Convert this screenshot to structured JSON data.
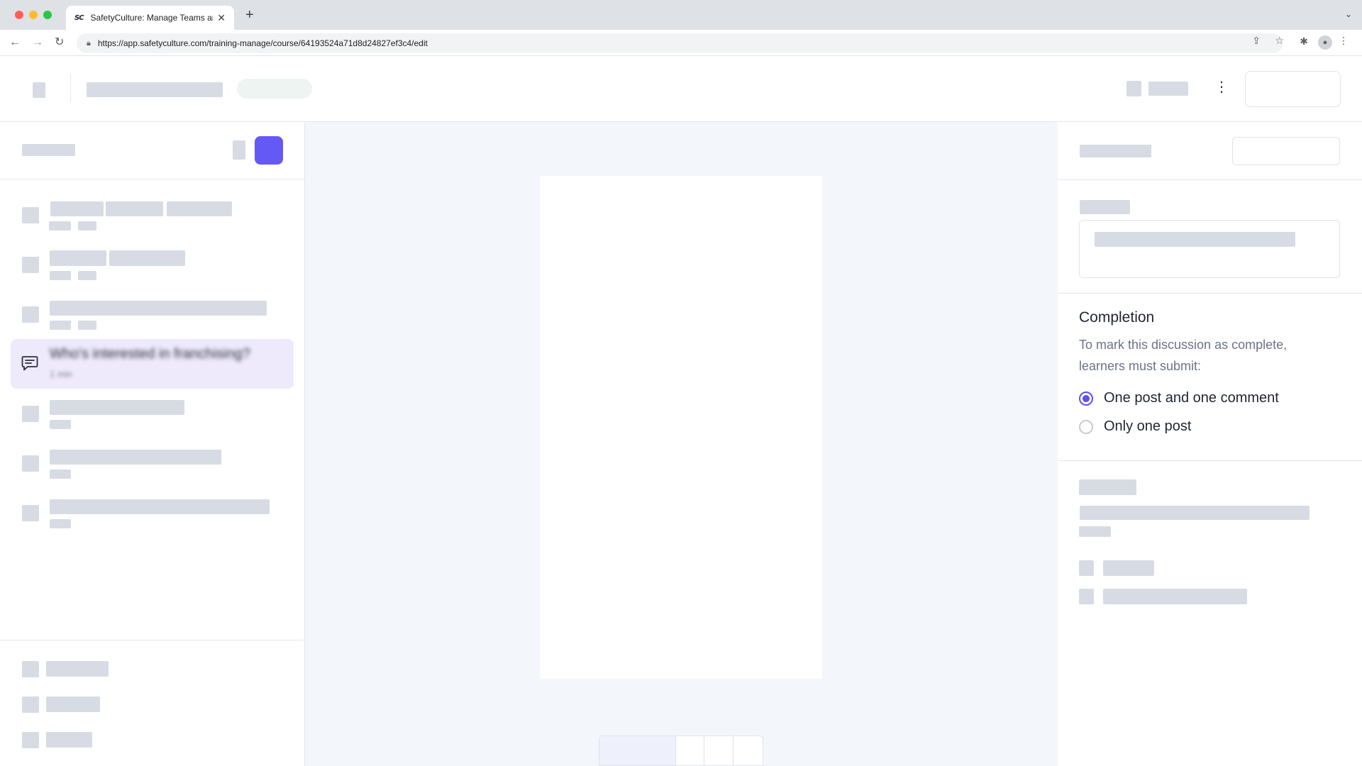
{
  "browser": {
    "tab_title": "SafetyCulture: Manage Teams and ...",
    "favicon_text": "SC",
    "url": "https://app.safetyculture.com/training-manage/course/64193524a71d8d24827ef3c4/edit",
    "icons": {
      "back": "arrow-left-icon",
      "forward": "arrow-right-icon",
      "reload": "reload-icon",
      "lock": "lock-icon",
      "share": "share-icon",
      "bookmark": "star-icon",
      "extensions": "puzzle-icon",
      "profile": "profile-icon",
      "menu": "kebab-icon"
    }
  },
  "course_outline": {
    "selected_item": {
      "title": "Who's interested in franchising?",
      "subtitle": "1 min"
    }
  },
  "settings_panel": {
    "completion": {
      "title": "Completion",
      "description": "To mark this discussion as complete, learners must submit:",
      "options": [
        {
          "label": "One post and one comment",
          "checked": true
        },
        {
          "label": "Only one post",
          "checked": false
        }
      ]
    }
  },
  "colors": {
    "accent": "#6559f5",
    "selected_bg": "#eeeafc",
    "skeleton": "#d7dbe3",
    "canvas_bg": "#f3f6fa"
  }
}
